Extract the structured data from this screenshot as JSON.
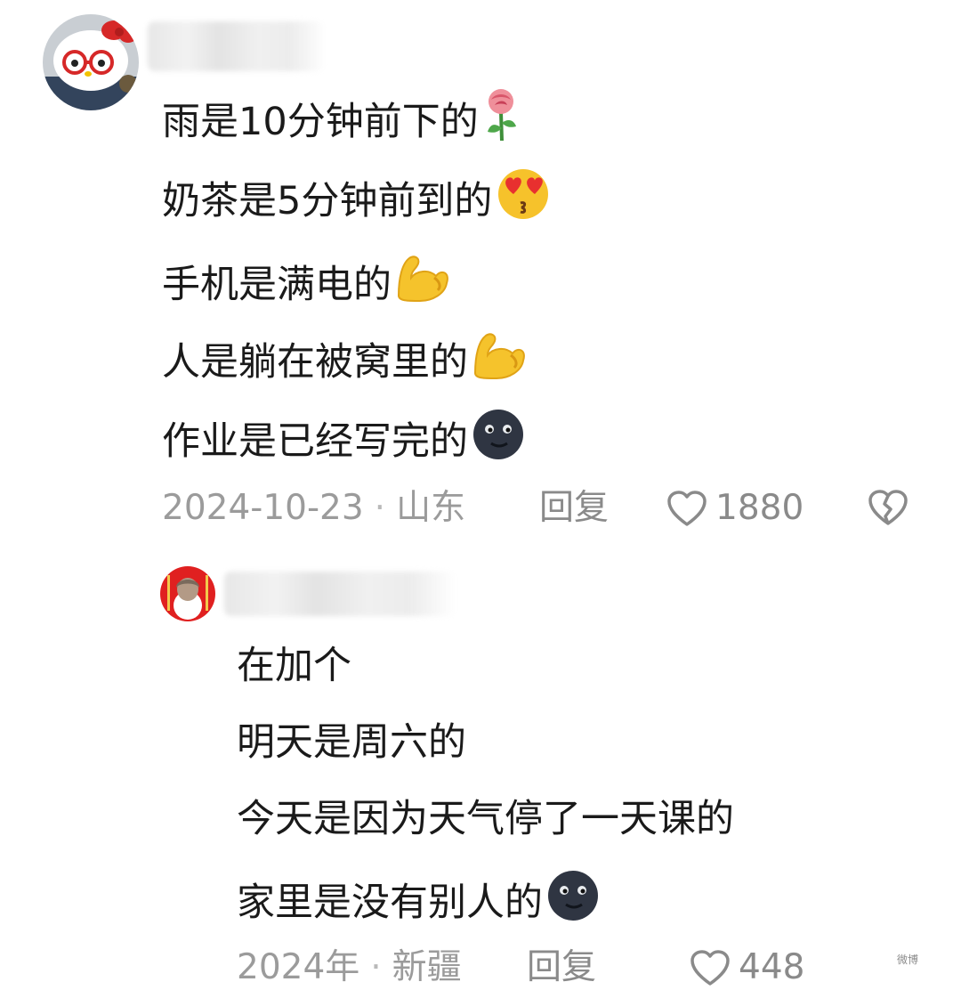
{
  "comments": [
    {
      "lines": [
        "雨是10分钟前下的",
        "奶茶是5分钟前到的",
        "手机是满电的",
        "人是躺在被窝里的",
        "作业是已经写完的"
      ],
      "line_icons": [
        "rose-icon",
        "kissing-heart-eyes-icon",
        "flexed-biceps-icon",
        "flexed-biceps-icon",
        "new-moon-face-icon"
      ],
      "date": "2024-10-23",
      "separator": "·",
      "location": "山东",
      "reply_label": "回复",
      "like_count": "1880"
    },
    {
      "lines": [
        "在加个",
        "明天是周六的",
        "今天是因为天气停了一天课的",
        "家里是没有别人的"
      ],
      "line_icons": [
        "",
        "",
        "",
        "new-moon-face-icon"
      ],
      "date": "2024年",
      "separator": "·",
      "location": "新疆",
      "reply_label": "回复",
      "like_count": "448"
    }
  ],
  "watermark_text": "微博",
  "colors": {
    "text": "#1a1a1a",
    "meta": "#9b9b9b",
    "accent_red": "#e02020"
  }
}
